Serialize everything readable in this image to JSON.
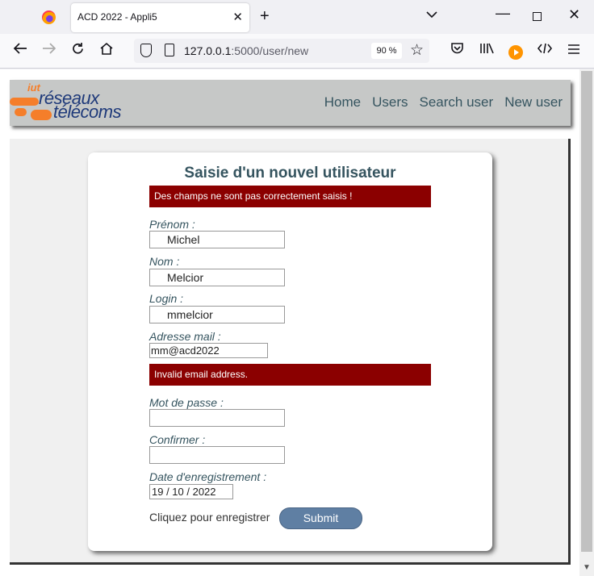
{
  "browser": {
    "tab_title": "ACD 2022 - Appli5",
    "tab_close": "✕",
    "new_tab": "+",
    "tab_list": "⌄",
    "url_host": "127.0.0.1",
    "url_path": ":5000/user/new",
    "zoom": "90 %"
  },
  "site": {
    "logo_iut": "iut",
    "logo_line1": "réseaux",
    "logo_line2": "télécoms",
    "menu": [
      "Home",
      "Users",
      "Search user",
      "New user"
    ]
  },
  "form": {
    "title": "Saisie d'un nouvel utilisateur",
    "error_top": "Des champs ne sont pas correctement saisis !",
    "prenom_label": "Prénom :",
    "prenom_value": "Michel",
    "nom_label": "Nom :",
    "nom_value": "Melcior",
    "login_label": "Login :",
    "login_value": "mmelcior",
    "email_label": "Adresse mail :",
    "email_value": "mm@acd2022",
    "email_error": "Invalid email address.",
    "password_label": "Mot de passe :",
    "password_value": "",
    "confirm_label": "Confirmer :",
    "confirm_value": "",
    "date_label": "Date d'enregistrement :",
    "date_value": "19 / 10 / 2022",
    "register_text": "Cliquez pour enregistrer",
    "submit_label": "Submit"
  },
  "colors": {
    "error_bg": "#8b0000",
    "header_bg": "#c6c8c7",
    "title_color": "#35545f",
    "submit_bg": "#5f7fa3"
  }
}
